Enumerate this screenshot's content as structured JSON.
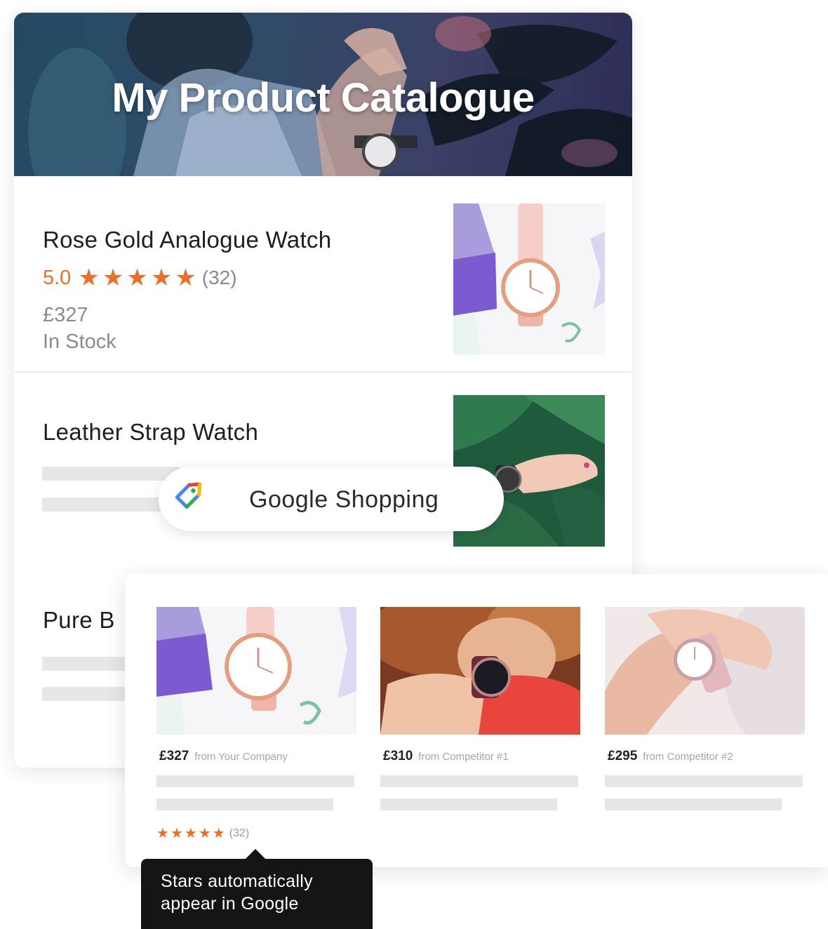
{
  "catalogue": {
    "title": "My Product Catalogue",
    "items": [
      {
        "name": "Rose Gold Analogue Watch",
        "rating": "5.0",
        "stars": [
          "★",
          "★",
          "★",
          "★",
          "★"
        ],
        "rating_count": "(32)",
        "price": "£327",
        "stock": "In Stock"
      },
      {
        "name": "Leather Strap Watch"
      },
      {
        "name": "Pure B"
      }
    ]
  },
  "google_shopping": {
    "label": "Google Shopping",
    "icon": "google-tag-icon"
  },
  "comparison": {
    "products": [
      {
        "price": "£327",
        "from": "from Your Company",
        "stars": [
          "★",
          "★",
          "★",
          "★",
          "★"
        ],
        "rating_count": "(32)"
      },
      {
        "price": "£310",
        "from": "from Competitor #1"
      },
      {
        "price": "£295",
        "from": "from Competitor #2"
      }
    ]
  },
  "tooltip": {
    "line1": "Stars automatically",
    "line2": "appear in Google"
  },
  "colors": {
    "accent_orange": "#e8702a",
    "hero_overlay": "#2f4c68",
    "tooltip_bg": "#141414",
    "placeholder": "#e7e7e7"
  }
}
